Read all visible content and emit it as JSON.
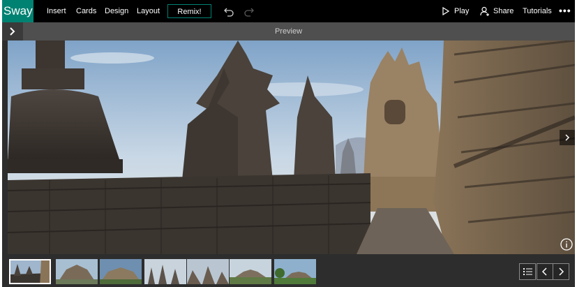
{
  "app": {
    "name": "Sway"
  },
  "menu": {
    "insert": "Insert",
    "cards": "Cards",
    "design": "Design",
    "layout": "Layout",
    "remix": "Remix!"
  },
  "toolbar": {
    "undo_icon": "undo-icon",
    "redo_icon": "redo-icon",
    "play": "Play",
    "share": "Share",
    "tutorials": "Tutorials",
    "more": "•••"
  },
  "preview": {
    "title": "Preview"
  },
  "filmstrip": {
    "selected_index": 0,
    "thumbnails": [
      {
        "scene": "stupa-terrace"
      },
      {
        "scene": "temple-wide"
      },
      {
        "scene": "temple-aerial"
      },
      {
        "scene": "stupas-row"
      },
      {
        "scene": "stupas-close"
      },
      {
        "scene": "temple-distance"
      },
      {
        "scene": "temple-trees"
      }
    ]
  },
  "colors": {
    "accent": "#008272",
    "topbar": "#000000",
    "preview_bar": "#4f4f4f",
    "panel": "#2d2d2d"
  }
}
